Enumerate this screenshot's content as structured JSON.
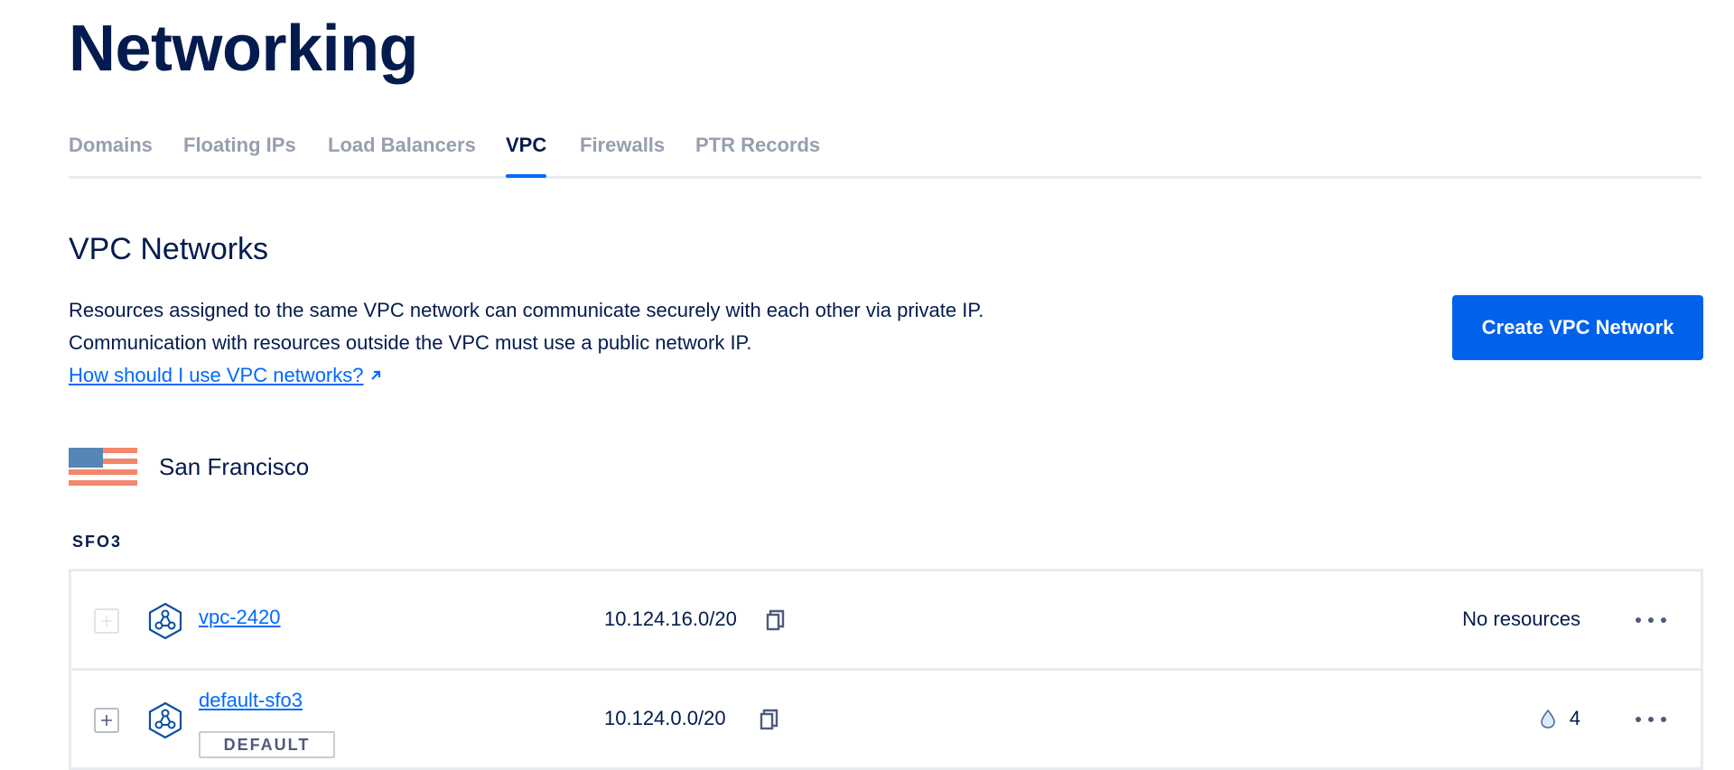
{
  "page": {
    "title": "Networking"
  },
  "tabs": [
    {
      "label": "Domains",
      "active": false
    },
    {
      "label": "Floating IPs",
      "active": false
    },
    {
      "label": "Load Balancers",
      "active": false
    },
    {
      "label": "VPC",
      "active": true
    },
    {
      "label": "Firewalls",
      "active": false
    },
    {
      "label": "PTR Records",
      "active": false
    }
  ],
  "section": {
    "title": "VPC Networks",
    "description_line1": "Resources assigned to the same VPC network can communicate securely with each other via private IP.",
    "description_line2": "Communication with resources outside the VPC must use a public network IP.",
    "help_link": "How should I use VPC networks?",
    "create_button": "Create VPC Network"
  },
  "region": {
    "name": "San Francisco",
    "flag_icon": "us-flag-icon",
    "datacenter": "SFO3"
  },
  "vpcs": [
    {
      "name": "vpc-2420",
      "ip_range": "10.124.16.0/20",
      "resources": "No resources",
      "is_default": false,
      "badge": ""
    },
    {
      "name": "default-sfo3",
      "ip_range": "10.124.0.0/20",
      "resources": "4",
      "is_default": true,
      "badge": "DEFAULT"
    }
  ],
  "colors": {
    "primary": "#0069ff",
    "button": "#0061eb",
    "text": "#031b4e",
    "muted": "#969faf",
    "border": "#e8ebf0",
    "flag_blue": "#5586b5",
    "flag_stripe": "#f3866b"
  }
}
